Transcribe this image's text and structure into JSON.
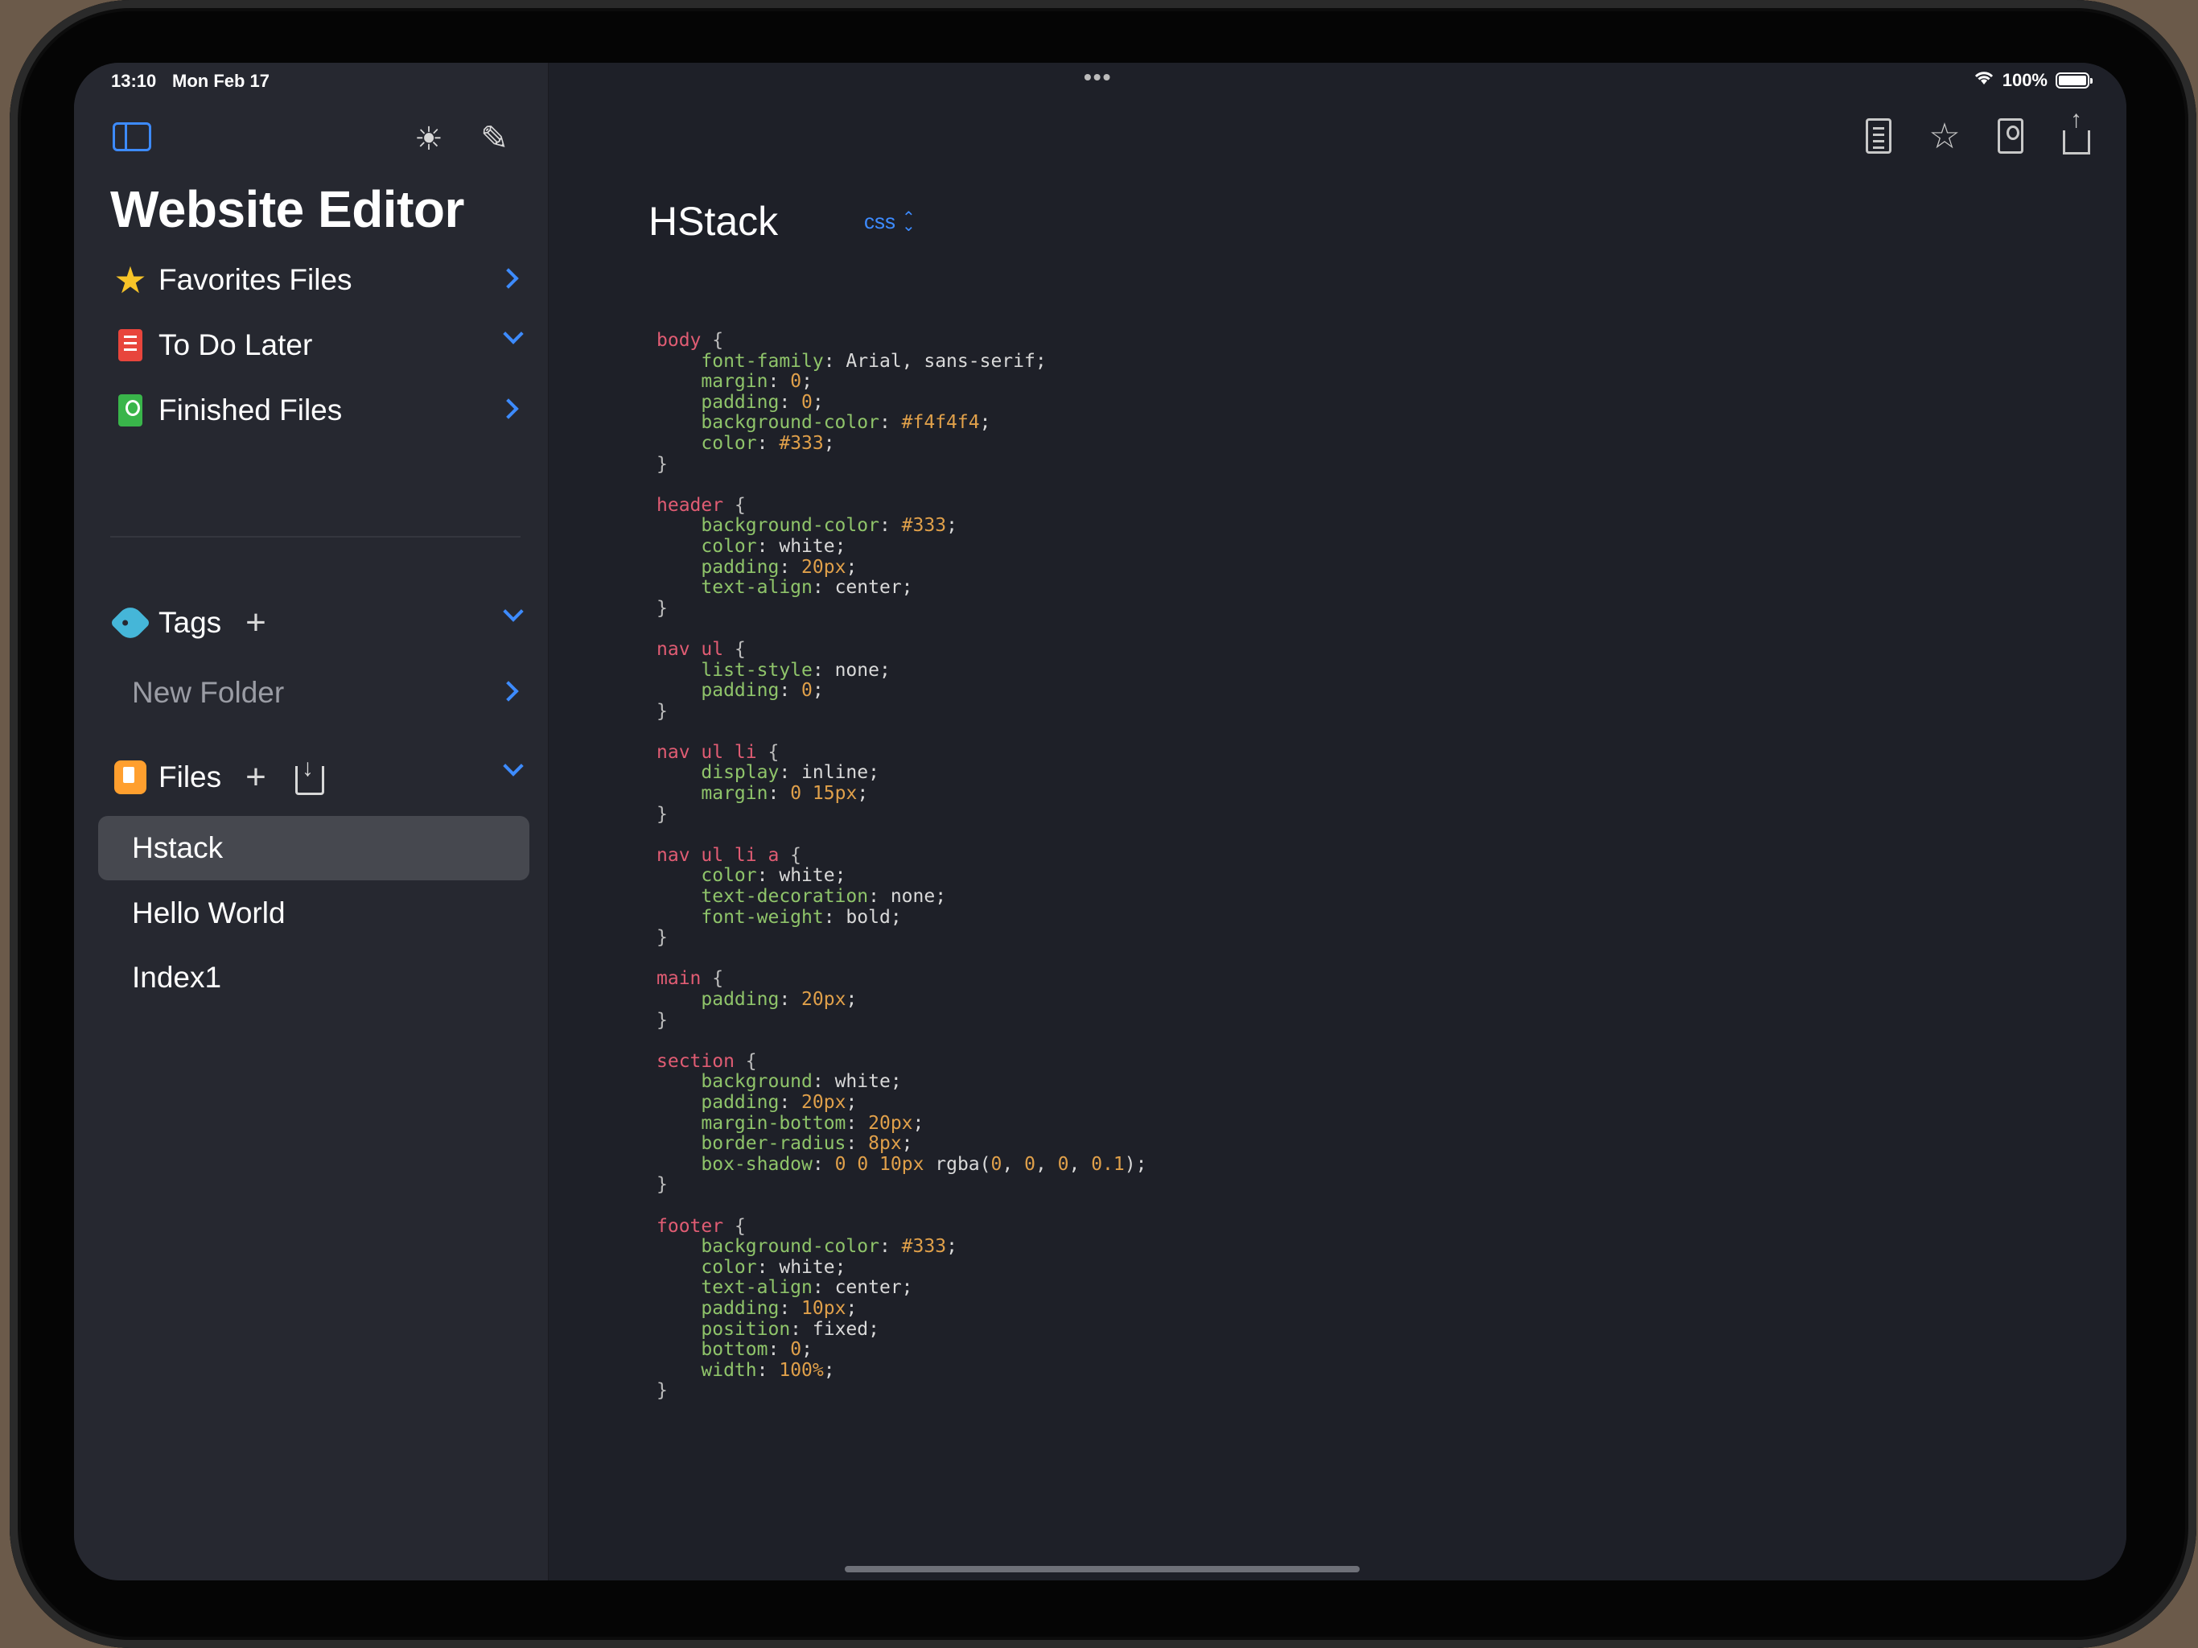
{
  "status_bar": {
    "time": "13:10",
    "date": "Mon Feb 17",
    "battery": "100%",
    "battery_level": 1.0
  },
  "sidebar": {
    "title": "Website Editor",
    "sections": [
      {
        "label": "Favorites Files",
        "icon": "star-icon",
        "chevron": "right"
      },
      {
        "label": "To Do Later",
        "icon": "red-book-icon",
        "chevron": "down"
      },
      {
        "label": "Finished Files",
        "icon": "green-book-icon",
        "chevron": "right"
      }
    ],
    "tags": {
      "label": "Tags",
      "folders": [
        "New Folder"
      ]
    },
    "files": {
      "label": "Files",
      "items": [
        "Hstack",
        "Hello World",
        "Index1"
      ],
      "selected": "Hstack"
    }
  },
  "editor": {
    "title": "HStack",
    "language": "css",
    "code": [
      {
        "t": "body {",
        "k": "sel"
      },
      {
        "t": "    font-family: Arial, sans-serif;",
        "k": "line"
      },
      {
        "t": "    margin: 0;",
        "k": "line"
      },
      {
        "t": "    padding: 0;",
        "k": "line"
      },
      {
        "t": "    background-color: #f4f4f4;",
        "k": "line"
      },
      {
        "t": "    color: #333;",
        "k": "line"
      },
      {
        "t": "}",
        "k": "brace"
      },
      {
        "t": "",
        "k": "blank"
      },
      {
        "t": "header {",
        "k": "sel"
      },
      {
        "t": "    background-color: #333;",
        "k": "line"
      },
      {
        "t": "    color: white;",
        "k": "line"
      },
      {
        "t": "    padding: 20px;",
        "k": "line"
      },
      {
        "t": "    text-align: center;",
        "k": "line"
      },
      {
        "t": "}",
        "k": "brace"
      },
      {
        "t": "",
        "k": "blank"
      },
      {
        "t": "nav ul {",
        "k": "sel"
      },
      {
        "t": "    list-style: none;",
        "k": "line"
      },
      {
        "t": "    padding: 0;",
        "k": "line"
      },
      {
        "t": "}",
        "k": "brace"
      },
      {
        "t": "",
        "k": "blank"
      },
      {
        "t": "nav ul li {",
        "k": "sel"
      },
      {
        "t": "    display: inline;",
        "k": "line"
      },
      {
        "t": "    margin: 0 15px;",
        "k": "line"
      },
      {
        "t": "}",
        "k": "brace"
      },
      {
        "t": "",
        "k": "blank"
      },
      {
        "t": "nav ul li a {",
        "k": "sel"
      },
      {
        "t": "    color: white;",
        "k": "line"
      },
      {
        "t": "    text-decoration: none;",
        "k": "line"
      },
      {
        "t": "    font-weight: bold;",
        "k": "line"
      },
      {
        "t": "}",
        "k": "brace"
      },
      {
        "t": "",
        "k": "blank"
      },
      {
        "t": "main {",
        "k": "sel"
      },
      {
        "t": "    padding: 20px;",
        "k": "line"
      },
      {
        "t": "}",
        "k": "brace"
      },
      {
        "t": "",
        "k": "blank"
      },
      {
        "t": "section {",
        "k": "sel"
      },
      {
        "t": "    background: white;",
        "k": "line"
      },
      {
        "t": "    padding: 20px;",
        "k": "line"
      },
      {
        "t": "    margin-bottom: 20px;",
        "k": "line"
      },
      {
        "t": "    border-radius: 8px;",
        "k": "line"
      },
      {
        "t": "    box-shadow: 0 0 10px rgba(0, 0, 0, 0.1);",
        "k": "line"
      },
      {
        "t": "}",
        "k": "brace"
      },
      {
        "t": "",
        "k": "blank"
      },
      {
        "t": "footer {",
        "k": "sel"
      },
      {
        "t": "    background-color: #333;",
        "k": "line"
      },
      {
        "t": "    color: white;",
        "k": "line"
      },
      {
        "t": "    text-align: center;",
        "k": "line"
      },
      {
        "t": "    padding: 10px;",
        "k": "line"
      },
      {
        "t": "    position: fixed;",
        "k": "line"
      },
      {
        "t": "    bottom: 0;",
        "k": "line"
      },
      {
        "t": "    width: 100%;",
        "k": "line"
      },
      {
        "t": "}",
        "k": "brace"
      }
    ]
  },
  "colors": {
    "accent": "#3d8bff",
    "selector": "#e05c73",
    "property": "#8fc46a",
    "number": "#e0a04a",
    "background": "#1e2028",
    "sidebar_bg": "#262830"
  }
}
